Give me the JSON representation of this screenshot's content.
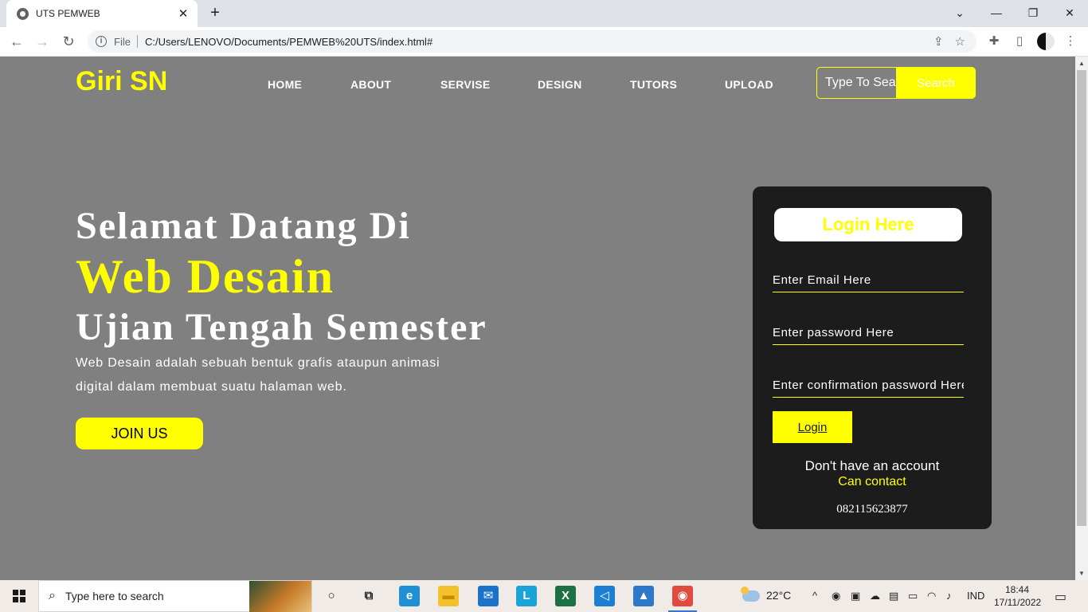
{
  "browser": {
    "tab_title": "UTS PEMWEB",
    "tab_close": "✕",
    "new_tab": "+",
    "minimize": "—",
    "restore": "❐",
    "close": "✕",
    "back": "←",
    "forward": "→",
    "reload": "↻",
    "info_glyph": "i",
    "url_scheme_label": "File",
    "url": "C:/Users/LENOVO/Documents/PEMWEB%20UTS/index.html#",
    "share_glyph": "⇪",
    "bookmark_glyph": "☆",
    "extensions_glyph": "✚",
    "sidepanel_glyph": "▯",
    "menu_glyph": "⋮"
  },
  "site": {
    "logo": "Giri SN",
    "nav": [
      "HOME",
      "ABOUT",
      "SERVISE",
      "DESIGN",
      "TUTORS",
      "UPLOAD"
    ],
    "search_placeholder": "Type To Search",
    "search_button": "Search",
    "accent_color": "#ffff00"
  },
  "hero": {
    "line1": "Selamat Datang Di",
    "line2": "Web Desain",
    "line3": "Ujian Tengah Semester",
    "description": "Web Desain adalah sebuah bentuk grafis ataupun animasi digital dalam membuat suatu halaman web.",
    "join_button": "JOIN US"
  },
  "login": {
    "title": "Login Here",
    "email_placeholder": "Enter Email Here",
    "password_placeholder": "Enter password Here",
    "confirm_placeholder": "Enter confirmation password Here",
    "button": "Login",
    "no_account": "Don't have an account",
    "contact_link": "Can contact",
    "phone": "082115623877"
  },
  "taskbar": {
    "search_glyph": "⌕",
    "search_text": "Type here to search",
    "weather_temp": "22°C",
    "language": "IND",
    "time": "18:44",
    "date": "17/11/2022",
    "apps": [
      {
        "name": "cortana",
        "glyph": "○",
        "color": "#f0ebe6",
        "fg": "#222"
      },
      {
        "name": "task-view",
        "glyph": "⧉",
        "color": "#f0ebe6",
        "fg": "#222"
      },
      {
        "name": "edge",
        "glyph": "e",
        "color": "#1f8fd6",
        "fg": "#fff"
      },
      {
        "name": "file-explorer",
        "glyph": "▬",
        "color": "#f2c12e",
        "fg": "#c68a00"
      },
      {
        "name": "mail",
        "glyph": "✉",
        "color": "#1a73c9",
        "fg": "#fff"
      },
      {
        "name": "lapp",
        "glyph": "L",
        "color": "#1aa3d6",
        "fg": "#fff"
      },
      {
        "name": "excel",
        "glyph": "X",
        "color": "#1d7044",
        "fg": "#fff"
      },
      {
        "name": "vscode",
        "glyph": "◁",
        "color": "#1c7fd1",
        "fg": "#fff"
      },
      {
        "name": "photos",
        "glyph": "▲",
        "color": "#2e78c9",
        "fg": "#fff"
      },
      {
        "name": "chrome",
        "glyph": "◉",
        "color": "#e04b3d",
        "fg": "#fff"
      }
    ],
    "tray_glyphs": [
      "^",
      "◉",
      "▣",
      "☁",
      "▤",
      "▭",
      "◠",
      "♪"
    ],
    "notification_glyph": "▭"
  }
}
